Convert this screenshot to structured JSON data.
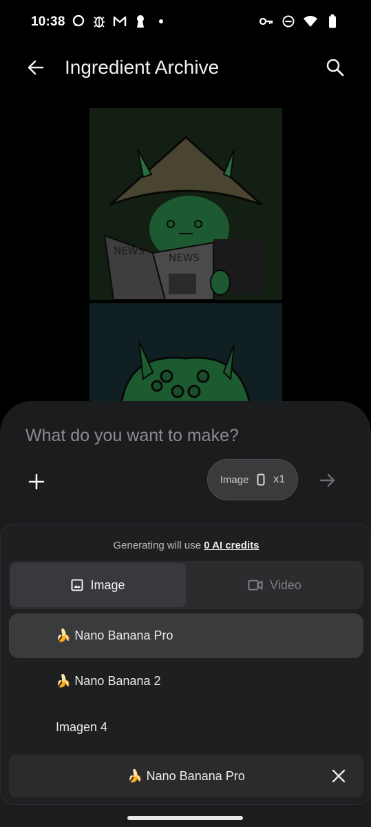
{
  "status_bar": {
    "time": "10:38",
    "notification_icons": [
      "chat-bubble-icon",
      "bug-icon",
      "gmail-icon",
      "keyhole-icon",
      "dot-icon"
    ],
    "system_icons": [
      "vpn-key-icon",
      "do-not-disturb-icon",
      "wifi-icon",
      "battery-icon"
    ]
  },
  "app_bar": {
    "title": "Ingredient Archive",
    "back_icon": "arrow-back-icon",
    "search_icon": "search-icon"
  },
  "composer": {
    "placeholder": "What do you want to make?",
    "add_icon": "plus-icon",
    "chip": {
      "label": "Image",
      "count": "x1",
      "icon": "portrait-aspect-icon"
    },
    "send_icon": "arrow-forward-icon"
  },
  "panel": {
    "credits_prefix": "Generating will use",
    "credits_link": "0 AI credits",
    "tabs": [
      {
        "label": "Image",
        "icon": "image-icon",
        "selected": true
      },
      {
        "label": "Video",
        "icon": "videocam-icon",
        "selected": false
      }
    ],
    "models": [
      {
        "label": "🍌 Nano Banana Pro",
        "selected": true
      },
      {
        "label": "🍌 Nano Banana 2",
        "selected": false
      },
      {
        "label": "Imagen 4",
        "selected": false
      }
    ],
    "selected_model": "🍌 Nano Banana Pro",
    "close_icon": "close-icon"
  }
}
